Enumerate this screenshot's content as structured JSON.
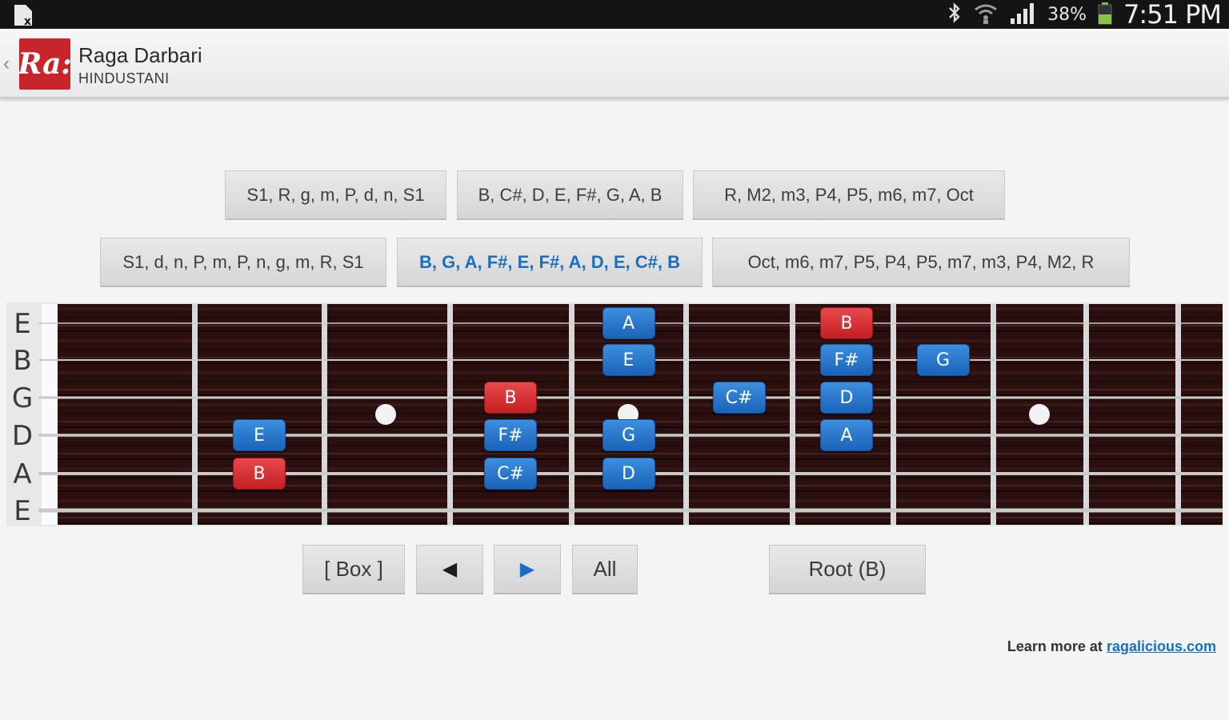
{
  "status_bar": {
    "battery_percent": "38%",
    "time": "7:51 PM",
    "icons": [
      "notification-icon",
      "bluetooth-icon",
      "wifi-icon",
      "signal-icon",
      "battery-icon"
    ]
  },
  "action_bar": {
    "icon_text": "Ra:",
    "title": "Raga Darbari",
    "subtitle": "HINDUSTANI",
    "accent_color": "#c8242b"
  },
  "scales": {
    "ascending": [
      "S1, R, g, m, P, d, n, S1",
      "B, C#, D, E, F#, G, A, B",
      "R, M2, m3, P4, P5, m6, m7, Oct"
    ],
    "descending": [
      "S1, d, n, P, m, P, n, g, m, R, S1",
      "B, G, A, F#, E, F#, A, D, E, C#, B",
      "Oct, m6, m7, P5, P4, P5, m7, m3, P4, M2, R"
    ],
    "active": "B, G, A, F#, E, F#, A, D, E, C#, B",
    "active_color": "#1a6fbf"
  },
  "fretboard": {
    "strings": [
      "E",
      "B",
      "G",
      "D",
      "A",
      "E"
    ],
    "notes": [
      {
        "name": "A",
        "string": 0,
        "fret": 5,
        "color": "blue"
      },
      {
        "name": "B",
        "string": 0,
        "fret": 7,
        "color": "red"
      },
      {
        "name": "E",
        "string": 1,
        "fret": 5,
        "color": "blue"
      },
      {
        "name": "F#",
        "string": 1,
        "fret": 7,
        "color": "blue"
      },
      {
        "name": "G",
        "string": 1,
        "fret": 8,
        "color": "blue"
      },
      {
        "name": "B",
        "string": 2,
        "fret": 4,
        "color": "red"
      },
      {
        "name": "C#",
        "string": 2,
        "fret": 6,
        "color": "blue"
      },
      {
        "name": "D",
        "string": 2,
        "fret": 7,
        "color": "blue"
      },
      {
        "name": "E",
        "string": 3,
        "fret": 2,
        "color": "blue"
      },
      {
        "name": "F#",
        "string": 3,
        "fret": 4,
        "color": "blue"
      },
      {
        "name": "G",
        "string": 3,
        "fret": 5,
        "color": "blue"
      },
      {
        "name": "A",
        "string": 3,
        "fret": 7,
        "color": "blue"
      },
      {
        "name": "B",
        "string": 4,
        "fret": 2,
        "color": "red"
      },
      {
        "name": "C#",
        "string": 4,
        "fret": 4,
        "color": "blue"
      },
      {
        "name": "D",
        "string": 4,
        "fret": 5,
        "color": "blue"
      }
    ],
    "note_colors": {
      "blue": "#1a63b8",
      "red": "#c41f23"
    }
  },
  "controls": {
    "box_label": "[ Box ]",
    "prev_icon": "◀",
    "next_icon": "▶",
    "all_label": "All",
    "root_label": "Root (B)"
  },
  "footer": {
    "text": "Learn more at",
    "link": "ragalicious.com"
  }
}
